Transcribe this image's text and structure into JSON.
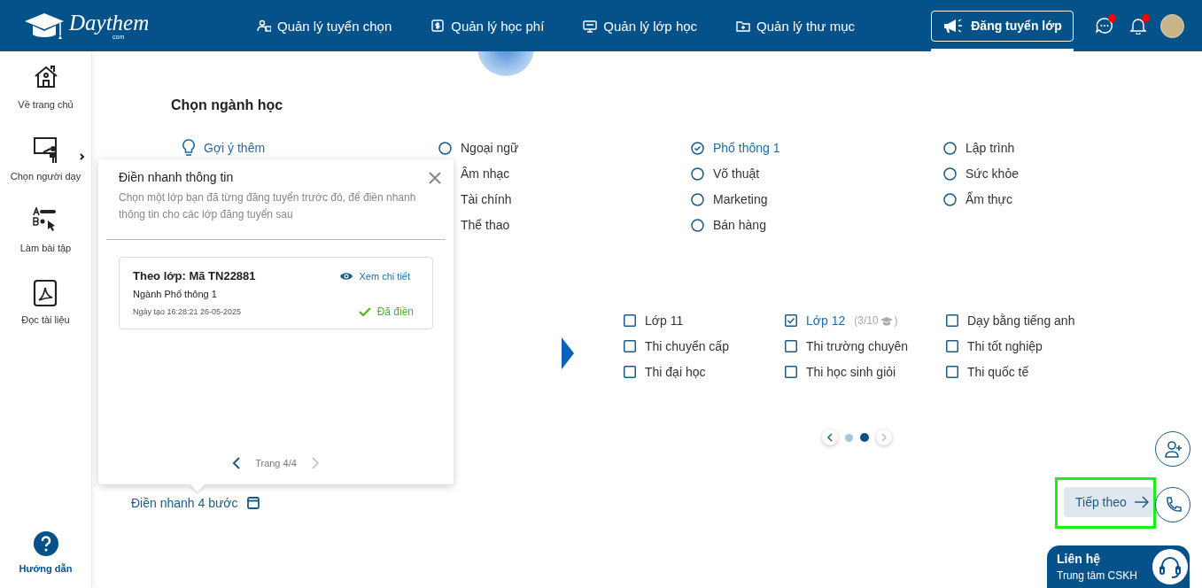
{
  "header": {
    "logo": {
      "name": "Daythem",
      "suffix": "com"
    },
    "nav": [
      {
        "label": "Quản lý tuyển chọn"
      },
      {
        "label": "Quản lý học phí"
      },
      {
        "label": "Quản lý lớp học"
      },
      {
        "label": "Quản lý thư mục"
      }
    ],
    "post_button": {
      "label": "Đăng tuyển lớp",
      "selected": true
    },
    "messages": {
      "unread": true
    },
    "notifications": {
      "unread": true
    }
  },
  "sidebar": {
    "items": [
      {
        "label": "Về trang chủ",
        "expandable": false
      },
      {
        "label": "Chọn người dạy",
        "expandable": true
      },
      {
        "label": "Làm bài tập",
        "expandable": false
      },
      {
        "label": "Đọc tài liệu",
        "expandable": false
      }
    ],
    "help": "Hướng dẫn"
  },
  "majors": {
    "title": "Chọn ngành học",
    "suggest": "Gợi ý thêm",
    "options": [
      {
        "label": "Ngoại ngữ",
        "selected": false
      },
      {
        "label": "Phổ thông 1",
        "selected": true
      },
      {
        "label": "Lập trình",
        "selected": false
      },
      {
        "label": "Âm nhạc"
      },
      {
        "label": "Võ thuật",
        "selected": false
      },
      {
        "label": "Sức khỏe",
        "selected": false
      },
      {
        "label": "Tài chính"
      },
      {
        "label": "Marketing",
        "selected": false
      },
      {
        "label": "Ẩm thực",
        "selected": false
      },
      {
        "label": "Thể thao"
      },
      {
        "label": "Bán hàng",
        "selected": false
      }
    ]
  },
  "grades": {
    "options": [
      {
        "label": "Lớp 11",
        "checked": false
      },
      {
        "label": "Lớp 12",
        "checked": true,
        "count": "(3/10",
        "count_end": ")"
      },
      {
        "label": "Dạy bằng tiếng anh",
        "checked": false
      },
      {
        "label": "Thi chuyển cấp",
        "checked": false
      },
      {
        "label": "Thi trường chuyên",
        "checked": false
      },
      {
        "label": "Thi tốt nghiệp",
        "checked": false
      },
      {
        "label": "Thi đại học",
        "checked": false
      },
      {
        "label": "Thi học sinh giỏi",
        "checked": false
      },
      {
        "label": "Thi quốc tế",
        "checked": false
      }
    ],
    "pages": [
      {
        "selected": false
      },
      {
        "selected": true
      }
    ]
  },
  "quick_fill": {
    "title": "Điền nhanh thông tin",
    "description": "Chọn một lớp bạn đã từng đăng tuyển trước đó, để điền nhanh thông tin cho các lớp đăng tuyển sau",
    "cards": [
      {
        "title": "Theo lớp: Mã TN22881",
        "detail_link": "Xem chi tiết",
        "major": "Ngành Phổ thông 1",
        "created": "Ngày tạo 16:28:21 26-05-2025",
        "status": "Đã điền",
        "filled": true
      }
    ],
    "page_label": "Trang 4/4",
    "prev_disabled": false,
    "next_disabled": true
  },
  "quick_fill_link": "Điền nhanh 4 bước",
  "next_button": "Tiếp theo",
  "contact": {
    "title": "Liên hệ",
    "subtitle": "Trung tâm CSKH"
  }
}
